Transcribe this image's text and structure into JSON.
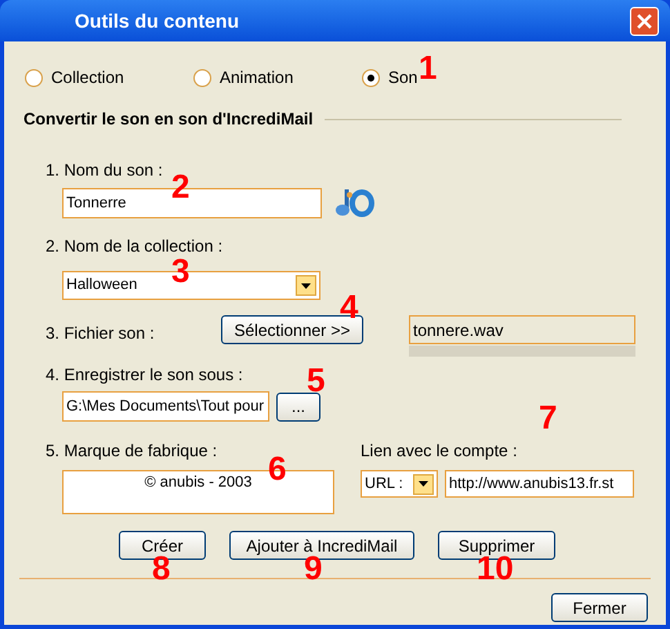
{
  "window": {
    "title": "Outils du contenu"
  },
  "modes": [
    {
      "label": "Collection",
      "selected": false
    },
    {
      "label": "Animation",
      "selected": false
    },
    {
      "label": "Son",
      "selected": true
    }
  ],
  "section_title": "Convertir le son en son d'IncrediMail",
  "sound_name": {
    "label": "1. Nom du son :",
    "value": "Tonnerre"
  },
  "collection": {
    "label": "2. Nom de la collection :",
    "value": "Halloween"
  },
  "sound_file": {
    "label": "3. Fichier son :",
    "button": "Sélectionner >>",
    "value": "tonnere.wav"
  },
  "save_as": {
    "label": "4. Enregistrer le son sous :",
    "value": "G:\\Mes Documents\\Tout pour",
    "button": "..."
  },
  "trademark": {
    "label": "5. Marque de fabrique :",
    "value": "© anubis - 2003"
  },
  "account_link": {
    "label": "Lien avec le compte :",
    "type": "URL :",
    "value": "http://www.anubis13.fr.st"
  },
  "actions": [
    "Créer",
    "Ajouter à IncrediMail",
    "Supprimer"
  ],
  "close_button": "Fermer",
  "callouts": [
    "1",
    "2",
    "3",
    "4",
    "5",
    "6",
    "7",
    "8",
    "9",
    "10"
  ]
}
